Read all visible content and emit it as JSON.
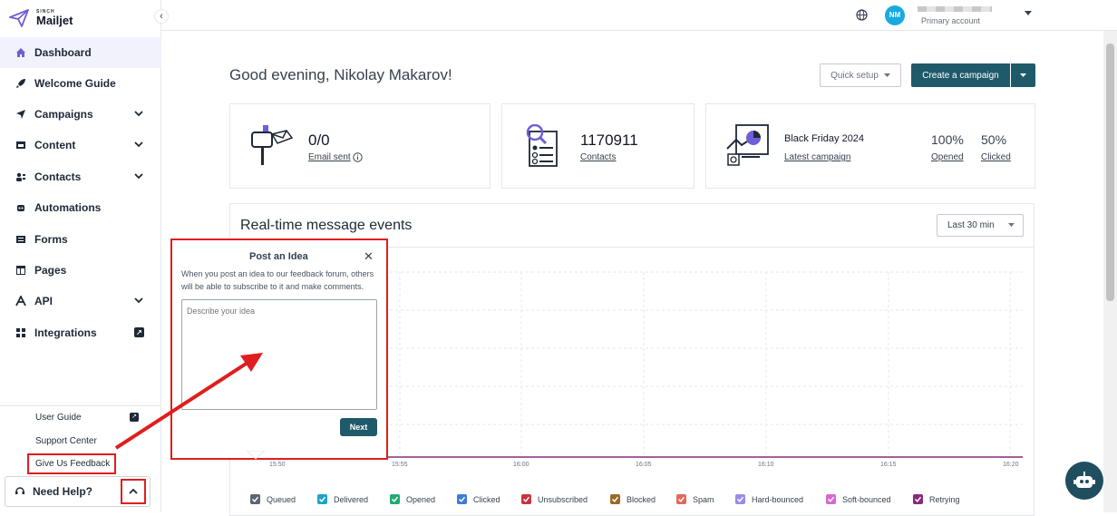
{
  "brand": {
    "small": "SINCH",
    "name": "Mailjet"
  },
  "sidebar": {
    "items": [
      {
        "label": "Dashboard"
      },
      {
        "label": "Welcome Guide"
      },
      {
        "label": "Campaigns"
      },
      {
        "label": "Content"
      },
      {
        "label": "Contacts"
      },
      {
        "label": "Automations"
      },
      {
        "label": "Forms"
      },
      {
        "label": "Pages"
      },
      {
        "label": "API"
      },
      {
        "label": "Integrations"
      }
    ],
    "bottom": [
      {
        "label": "User Guide"
      },
      {
        "label": "Support Center"
      },
      {
        "label": "Give Us Feedback"
      }
    ],
    "need_help": "Need Help?"
  },
  "topbar": {
    "avatar": "NM",
    "account_label": "Primary account"
  },
  "main": {
    "greeting": "Good evening, Nikolay Makarov!",
    "quick_setup": "Quick setup",
    "create_campaign": "Create a campaign"
  },
  "cards": {
    "email": {
      "value": "0/0",
      "label": "Email sent"
    },
    "contacts": {
      "value": "1170911",
      "label": "Contacts"
    },
    "campaign": {
      "name": "Black Friday 2024",
      "label": "Latest campaign",
      "opened_pct": "100%",
      "opened_label": "Opened",
      "clicked_pct": "50%",
      "clicked_label": "Clicked"
    }
  },
  "events": {
    "title": "Real-time message events",
    "range": "Last 30 min",
    "ticks": [
      "15:50",
      "15:55",
      "16:00",
      "16:05",
      "16:10",
      "16:15",
      "16:20"
    ],
    "legend": [
      {
        "label": "Queued",
        "color": "#5b6573"
      },
      {
        "label": "Delivered",
        "color": "#1fa3c6"
      },
      {
        "label": "Opened",
        "color": "#22a874"
      },
      {
        "label": "Clicked",
        "color": "#3b7dd8"
      },
      {
        "label": "Unsubscribed",
        "color": "#c8343c"
      },
      {
        "label": "Blocked",
        "color": "#9a6a25"
      },
      {
        "label": "Spam",
        "color": "#e5675c"
      },
      {
        "label": "Hard-bounced",
        "color": "#9b8bea"
      },
      {
        "label": "Soft-bounced",
        "color": "#d569d4"
      },
      {
        "label": "Retrying",
        "color": "#8a2a7a"
      }
    ]
  },
  "popup": {
    "title": "Post an Idea",
    "description": "When you post an idea to our feedback forum, others will be able to subscribe to it and make comments.",
    "placeholder": "Describe your idea",
    "next": "Next"
  }
}
